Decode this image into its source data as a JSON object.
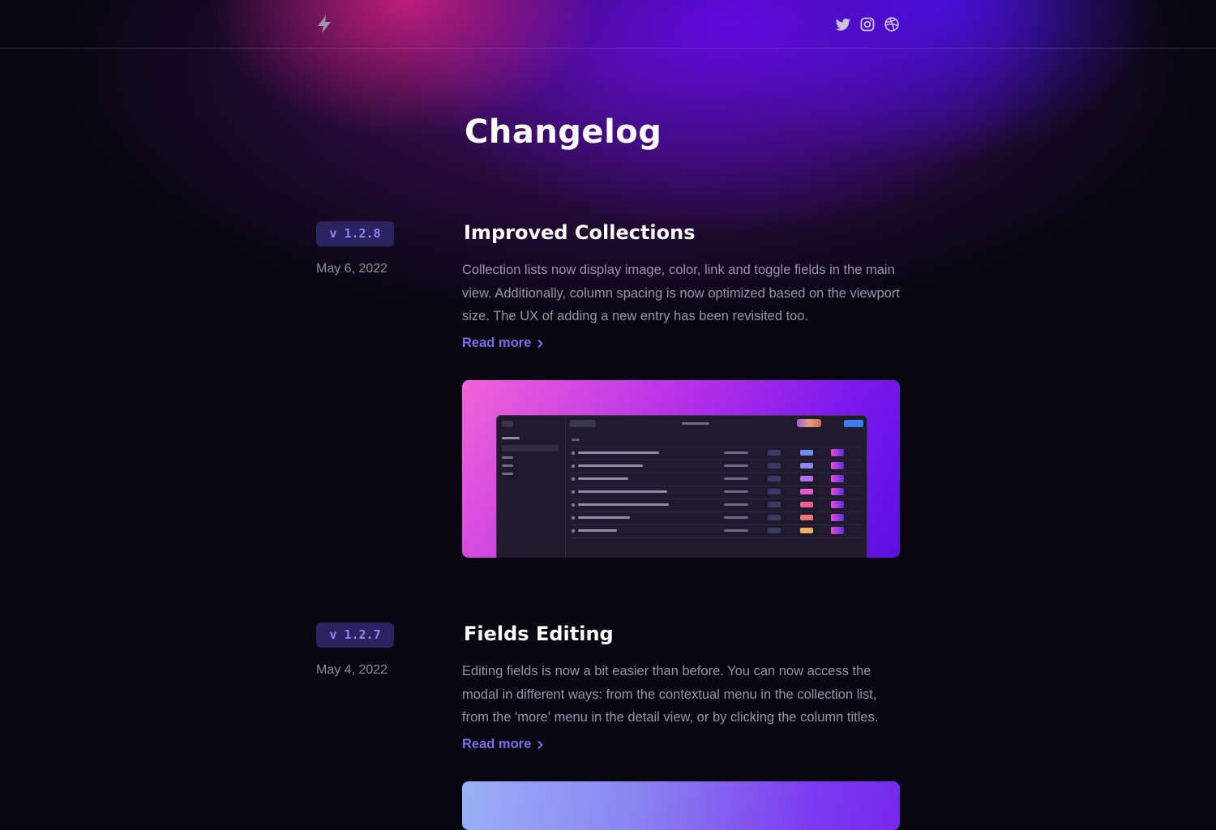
{
  "nav": {
    "logo_icon": "lightning-bolt-icon",
    "social_icons": [
      "twitter-icon",
      "instagram-icon",
      "dribbble-icon"
    ]
  },
  "page": {
    "title": "Changelog"
  },
  "entries": [
    {
      "version": "v 1.2.8",
      "date": "May 6, 2022",
      "title": "Improved Collections",
      "body": "Collection lists now display image, color, link and toggle fields in the main view. Additionally, column spacing is now optimized based on the viewport size. The UX of adding a new entry has been revisited too.",
      "read_more": "Read more"
    },
    {
      "version": "v 1.2.7",
      "date": "May 4, 2022",
      "title": "Fields Editing",
      "body": "Editing fields is now a bit easier than before. You can now access the modal in different ways: from the contextual menu in the collection list, from the 'more' menu in the detail view, or by clicking the column titles.",
      "read_more": "Read more"
    }
  ],
  "colors": {
    "background": "#080711",
    "accent": "#7c6ee8",
    "badge_bg": "#2a2360",
    "badge_text": "#8d86f2",
    "muted_text": "#9794a8",
    "glow_pink": "#d62186",
    "glow_purple": "#600ae6"
  }
}
